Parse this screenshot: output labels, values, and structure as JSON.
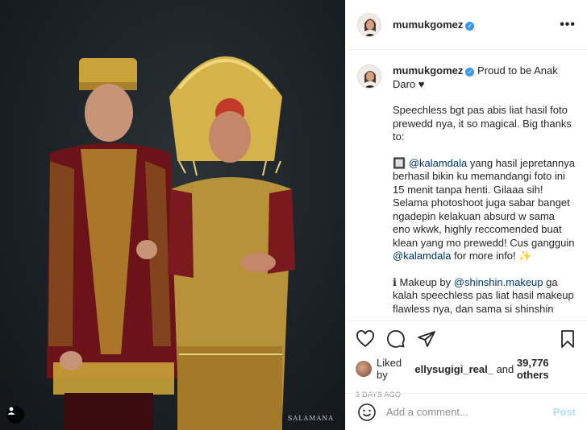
{
  "post": {
    "username": "mumukgomez",
    "verified_icon": "verified-badge-icon",
    "more_icon": "more-options-icon",
    "photo_watermark": "SALAMANA",
    "caption": {
      "line1": "Proud to be Anak Daro ♥",
      "para1": "Speechless bgt pas abis liat hasil foto prewedd nya, it so magical. Big thanks to:",
      "para2_prefix": "🔲 ",
      "mention1": "@kalamdala",
      "para2_text": " yang hasil jepretannya berhasil bikin ku memandangi foto ini 15 menit tanpa henti. Gilaaa sih! Selama photoshoot juga sabar banget ngadepin kelakuan absurd w sama eno wkwk, highly reccomended buat klean yang mo prewedd! Cus gangguin ",
      "mention2": "@kalamdala",
      "para2_suffix": " for more info! ✨",
      "para3_prefix": "ℹ Makeup by ",
      "mention3": "@shinshin.makeup",
      "para3_text": " ga kalah speechless pas liat hasil makeup flawless nya, dan sama si shinshin"
    },
    "likes": {
      "liked_by": "Liked by ",
      "user": "ellysugigi_real_",
      "and": " and ",
      "count": "39,776 others"
    },
    "date": "3 DAYS AGO",
    "comment": {
      "placeholder": "Add a comment...",
      "post_label": "Post"
    },
    "colors": {
      "accent": "#3897f0",
      "mention": "#00376b",
      "post_disabled": "#b2dffc",
      "muted": "#8e8e8e"
    }
  }
}
